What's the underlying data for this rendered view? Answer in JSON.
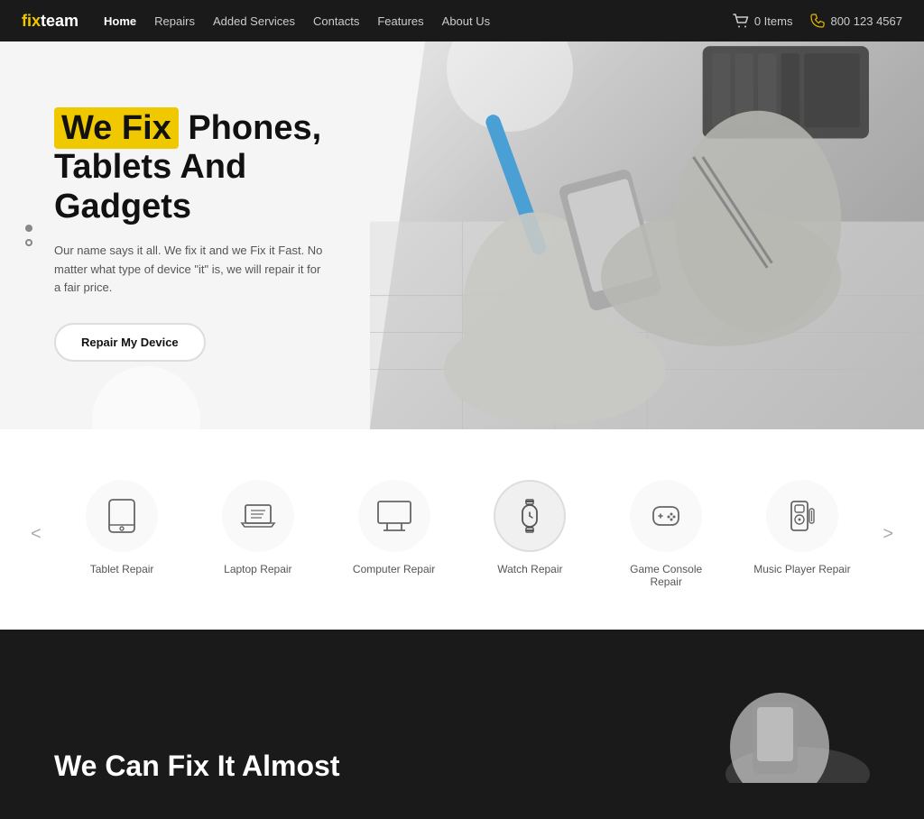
{
  "navbar": {
    "logo_fix": "fix",
    "logo_team": "team",
    "links": [
      {
        "label": "Home",
        "active": true
      },
      {
        "label": "Repairs",
        "active": false
      },
      {
        "label": "Added Services",
        "active": false
      },
      {
        "label": "Contacts",
        "active": false
      },
      {
        "label": "Features",
        "active": false
      },
      {
        "label": "About Us",
        "active": false
      }
    ],
    "cart_label": "0 Items",
    "phone_label": "800 123 4567"
  },
  "hero": {
    "title_highlight": "We Fix",
    "title_rest": " Phones,",
    "title_line2": "Tablets And",
    "title_line3": "Gadgets",
    "subtitle": "Our name says it all. We fix it and we Fix it Fast. No matter what type of device \"it\" is, we will repair it for a fair price.",
    "cta_label": "Repair My Device",
    "dot1": "active",
    "dot2": "inactive"
  },
  "services": {
    "items": [
      {
        "label": "Tablet Repair",
        "icon_name": "tablet-icon"
      },
      {
        "label": "Laptop Repair",
        "icon_name": "laptop-icon"
      },
      {
        "label": "Computer Repair",
        "icon_name": "computer-icon"
      },
      {
        "label": "Watch Repair",
        "icon_name": "watch-icon",
        "active": true
      },
      {
        "label": "Game Console Repair",
        "icon_name": "gamepad-icon"
      },
      {
        "label": "Music Player Repair",
        "icon_name": "music-player-icon"
      }
    ],
    "prev_label": "<",
    "next_label": ">"
  },
  "dark_section": {
    "title_line1": "We Can Fix It Almost"
  }
}
